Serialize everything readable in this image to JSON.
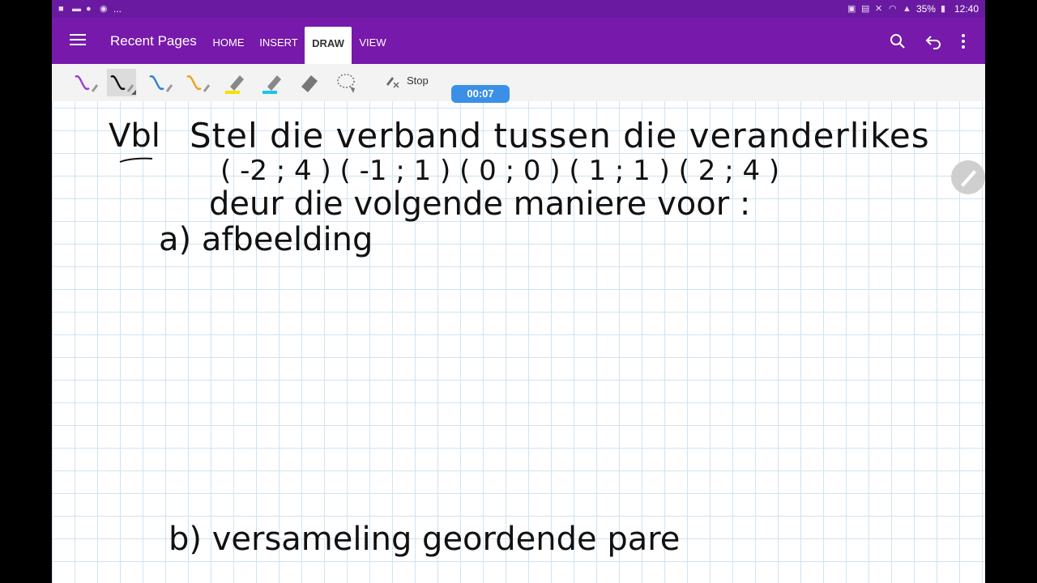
{
  "status_bar": {
    "left_more": "...",
    "battery": "35%",
    "time": "12:40"
  },
  "app": {
    "title": "Recent Pages"
  },
  "tabs": [
    {
      "label": "HOME"
    },
    {
      "label": "INSERT"
    },
    {
      "label": "DRAW"
    },
    {
      "label": "VIEW"
    }
  ],
  "toolbar": {
    "stop_label": "Stop",
    "pen_colors": [
      "#9b3fd4",
      "#111111",
      "#2f7fd8",
      "#f0a020"
    ],
    "highlighter_colors": [
      "#f5e100",
      "#19c7e8"
    ]
  },
  "recording": {
    "timer": "00:07"
  },
  "notes": {
    "line1_label": "Vbl",
    "line1_text": "Stel  die  verband  tussen  die  veranderlikes",
    "line2": "( -2 ; 4 )   ( -1 ; 1 )  ( 0 ; 0 )  ( 1 ; 1 )   ( 2 ; 4 )",
    "line3": "deur  die  volgende  maniere  voor :",
    "item_a": "a)  afbeelding",
    "item_b": "b)  versameling  geordende  pare"
  }
}
